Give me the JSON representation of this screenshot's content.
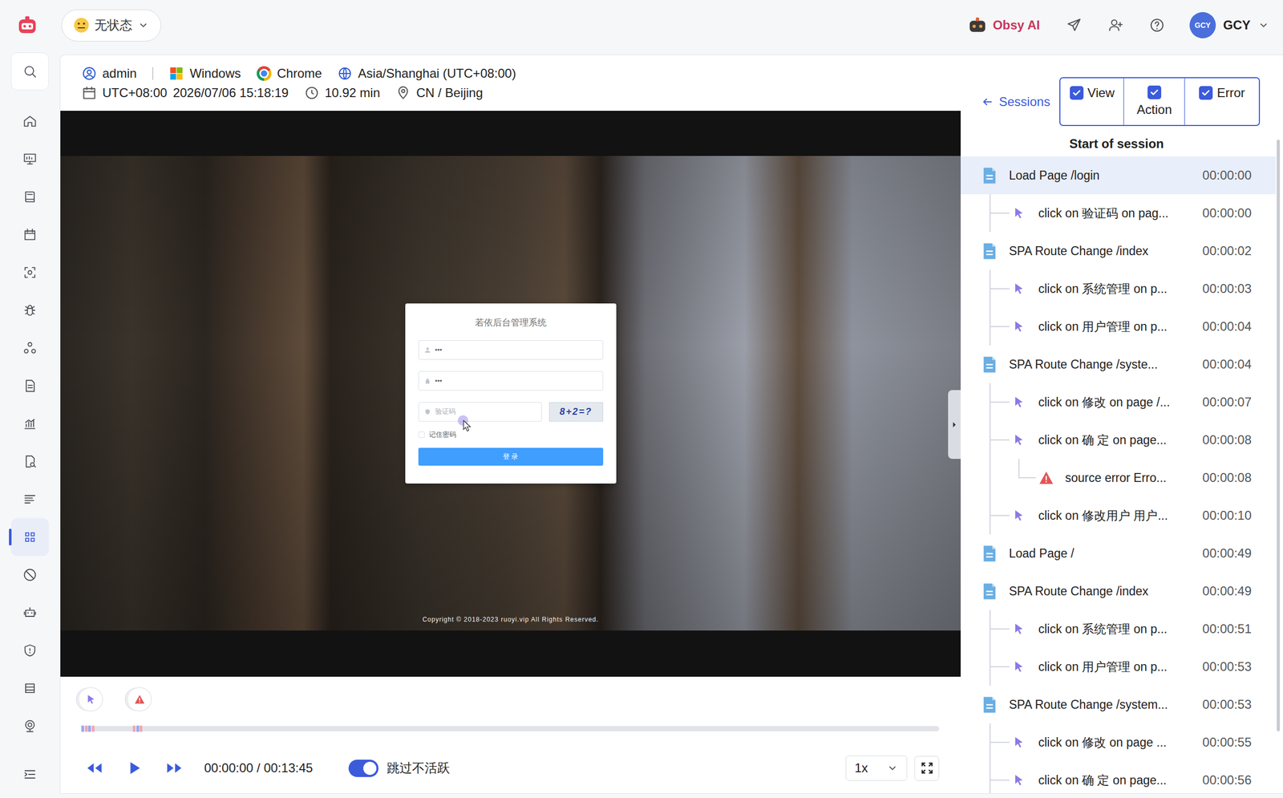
{
  "topbar": {
    "status": {
      "label": "无状态"
    },
    "assistant": "Obsy AI",
    "user": {
      "avatar": "GCY",
      "name": "GCY"
    }
  },
  "sidebar": {
    "items": [
      {
        "selected": false
      },
      {
        "selected": false
      },
      {
        "selected": false
      },
      {
        "selected": false
      },
      {
        "selected": false
      },
      {
        "selected": false
      },
      {
        "selected": false
      },
      {
        "selected": false
      },
      {
        "selected": false
      },
      {
        "selected": false
      },
      {
        "selected": false
      },
      {
        "selected": true
      },
      {
        "selected": false
      },
      {
        "selected": false
      },
      {
        "selected": false
      },
      {
        "selected": false
      },
      {
        "selected": false
      }
    ]
  },
  "session": {
    "user": "admin",
    "os": "Windows",
    "browser": "Chrome",
    "timezone": "Asia/Shanghai (UTC+08:00)",
    "utc": "UTC+08:00",
    "datetime": "2026/07/06 15:18:19",
    "duration": "10.92 min",
    "location": "CN / Beijing"
  },
  "replay": {
    "title": "若依后台管理系统",
    "fields": [
      {
        "kind": "user",
        "value": "•••"
      },
      {
        "kind": "password",
        "value": "•••"
      }
    ],
    "captcha": {
      "placeholder": "验证码",
      "image_text": "8+2=?"
    },
    "remember": {
      "label": "记住密码",
      "checked": false
    },
    "button": "登 录",
    "footer": "Copyright © 2018-2023 ruoyi.vip All Rights Reserved."
  },
  "player": {
    "event_markers": [
      {
        "kind": "click"
      },
      {
        "kind": "error"
      }
    ],
    "timeline": {
      "level": 0,
      "ticks": [
        {
          "at": 0.0,
          "color": "#9aa8ee"
        },
        {
          "at": 0.004,
          "color": "#f2a7b3"
        },
        {
          "at": 0.008,
          "color": "#9aa8ee"
        },
        {
          "at": 0.012,
          "color": "#f2a7b3"
        },
        {
          "at": 0.06,
          "color": "#f2a7b3"
        },
        {
          "at": 0.064,
          "color": "#9aa8ee"
        },
        {
          "at": 0.068,
          "color": "#f2a7b3"
        }
      ]
    },
    "time": "00:00:00 / 00:13:45",
    "skip_inactive": {
      "label": "跳过不活跃",
      "on": true
    },
    "speed": "1x"
  },
  "events_panel": {
    "back": "Sessions",
    "filters": [
      {
        "label": "View",
        "checked": true
      },
      {
        "label": "Action",
        "checked": true
      },
      {
        "label": "Error",
        "checked": true
      }
    ],
    "heading": "Start of session",
    "items": [
      {
        "kind": "page",
        "label": "Load Page /login",
        "time": "00:00:00",
        "selected": true
      },
      {
        "kind": "click",
        "label": "click on 验证码 on pag...",
        "time": "00:00:00",
        "selected": false
      },
      {
        "kind": "page",
        "label": "SPA Route Change /index",
        "time": "00:00:02",
        "selected": false
      },
      {
        "kind": "click",
        "label": "click on 系统管理 on p...",
        "time": "00:00:03",
        "selected": false
      },
      {
        "kind": "click",
        "label": "click on 用户管理 on p...",
        "time": "00:00:04",
        "selected": false
      },
      {
        "kind": "page",
        "label": "SPA Route Change /syste...",
        "time": "00:00:04",
        "selected": false
      },
      {
        "kind": "click",
        "label": "click on 修改 on page /...",
        "time": "00:00:07",
        "selected": false
      },
      {
        "kind": "click",
        "label": "click on 确 定 on page...",
        "time": "00:00:08",
        "selected": false
      },
      {
        "kind": "error",
        "label": "source error Erro...",
        "time": "00:00:08",
        "selected": false
      },
      {
        "kind": "click",
        "label": "click on 修改用户 用户...",
        "time": "00:00:10",
        "selected": false
      },
      {
        "kind": "page",
        "label": "Load Page /",
        "time": "00:00:49",
        "selected": false
      },
      {
        "kind": "page",
        "label": "SPA Route Change /index",
        "time": "00:00:49",
        "selected": false
      },
      {
        "kind": "click",
        "label": "click on 系统管理 on p...",
        "time": "00:00:51",
        "selected": false
      },
      {
        "kind": "click",
        "label": "click on 用户管理 on p...",
        "time": "00:00:53",
        "selected": false
      },
      {
        "kind": "page",
        "label": "SPA Route Change /system...",
        "time": "00:00:53",
        "selected": false
      },
      {
        "kind": "click",
        "label": "click on 修改 on page ...",
        "time": "00:00:55",
        "selected": false
      },
      {
        "kind": "click",
        "label": "click on 确 定 on page...",
        "time": "00:00:56",
        "selected": false
      }
    ]
  }
}
